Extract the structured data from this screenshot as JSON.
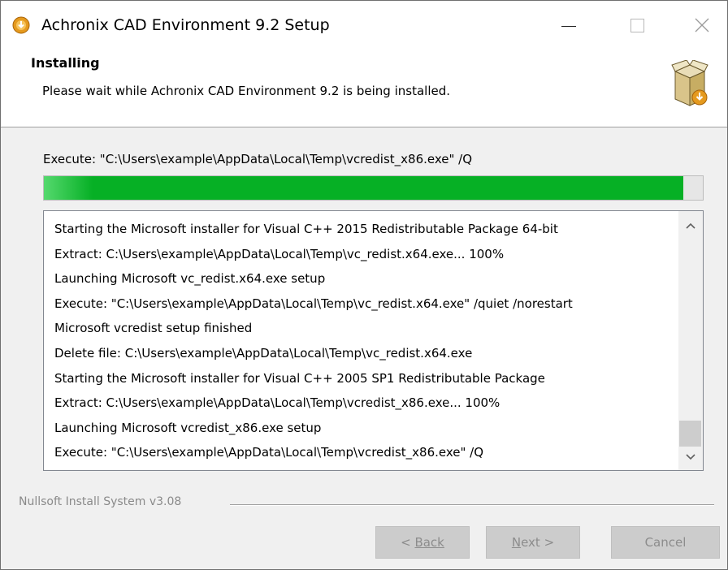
{
  "window": {
    "title": "Achronix CAD Environment 9.2 Setup",
    "controls": {
      "minimize": "minimize-icon",
      "maximize": "maximize-icon",
      "close": "close-icon"
    }
  },
  "header": {
    "title": "Installing",
    "subtitle": "Please wait while Achronix CAD Environment 9.2 is being installed.",
    "icon": "installer-box-icon"
  },
  "status": "Execute: \"C:\\Users\\example\\AppData\\Local\\Temp\\vcredist_x86.exe\" /Q",
  "progress": {
    "fraction": 0.97,
    "color": "#06b025"
  },
  "log": {
    "lines": [
      "Starting the Microsoft installer for Visual C++ 2015 Redistributable Package 64-bit",
      "Extract: C:\\Users\\example\\AppData\\Local\\Temp\\vc_redist.x64.exe... 100%",
      "Launching Microsoft vc_redist.x64.exe setup",
      "Execute: \"C:\\Users\\example\\AppData\\Local\\Temp\\vc_redist.x64.exe\" /quiet /norestart",
      "Microsoft vcredist setup finished",
      "Delete file: C:\\Users\\example\\AppData\\Local\\Temp\\vc_redist.x64.exe",
      "Starting the Microsoft installer for Visual C++ 2005 SP1 Redistributable Package",
      "Extract: C:\\Users\\example\\AppData\\Local\\Temp\\vcredist_x86.exe... 100%",
      "Launching Microsoft vcredist_x86.exe setup",
      "Execute: \"C:\\Users\\example\\AppData\\Local\\Temp\\vcredist_x86.exe\" /Q"
    ]
  },
  "footer": {
    "brand": "Nullsoft Install System v3.08",
    "back_label": "Back",
    "back_prefix": "< ",
    "next_label": "Next >",
    "next_mnemonic": "N",
    "next_rest": "ext >",
    "cancel_label": "Cancel"
  }
}
